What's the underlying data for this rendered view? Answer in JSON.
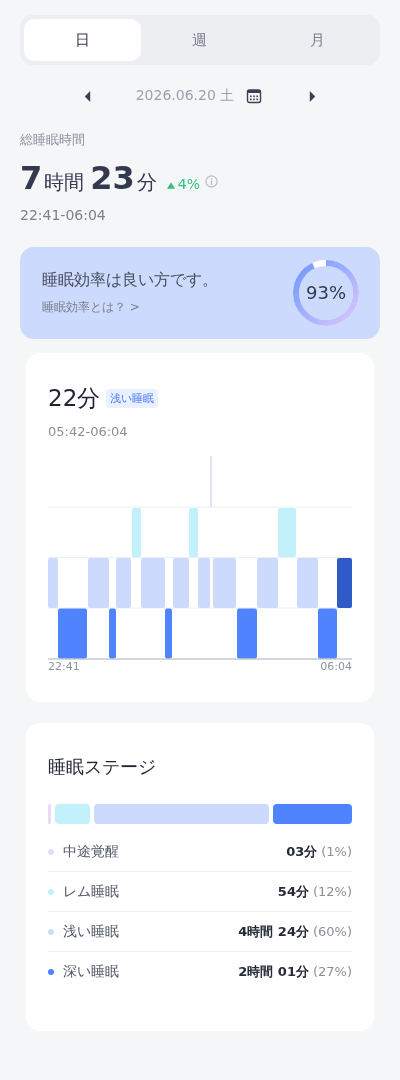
{
  "tabs": [
    {
      "label": "日",
      "selected": true
    },
    {
      "label": "週",
      "selected": false
    },
    {
      "label": "月",
      "selected": false
    }
  ],
  "date": "2026.06.20 土",
  "total": {
    "label": "総睡眠時間",
    "hours": "7",
    "hours_unit": "時間",
    "minutes": "23",
    "minutes_unit": "分",
    "change": "4%",
    "range": "22:41-06:04"
  },
  "efficiency": {
    "message": "睡眠効率は良い方です。",
    "link": "睡眠効率とは？ >",
    "value": "93%"
  },
  "segment": {
    "duration": "22分",
    "stage": "浅い睡眠",
    "range": "05:42-06:04",
    "start": "22:41",
    "end": "06:04"
  },
  "stages": {
    "title": "睡眠ステージ",
    "items": [
      {
        "name": "中途覚醒",
        "color": "#e6dcf8",
        "duration": "03分",
        "share": "(1%)"
      },
      {
        "name": "レム睡眠",
        "color": "#c2f0fb",
        "duration": "54分",
        "share": "(12%)"
      },
      {
        "name": "浅い睡眠",
        "color": "#ccdafd",
        "duration": "4時間 24分",
        "share": "(60%)"
      },
      {
        "name": "深い睡眠",
        "color": "#5083fe",
        "duration": "2時間 01分",
        "share": "(27%)"
      }
    ]
  }
}
